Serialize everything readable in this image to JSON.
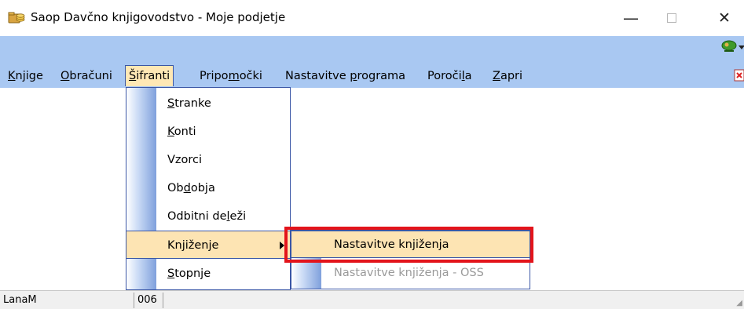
{
  "window": {
    "title": "Saop Davčno knjigovodstvo - Moje podjetje",
    "icon": "coins-folder-icon",
    "minimize_glyph": "—",
    "close_glyph": "✕"
  },
  "toolbar": {
    "icon": "tree-person-icon"
  },
  "menubar": {
    "items": [
      {
        "pre": "",
        "key": "K",
        "post": "njige"
      },
      {
        "pre": "",
        "key": "O",
        "post": "bračuni"
      },
      {
        "pre": "",
        "key": "Š",
        "post": "ifranti"
      },
      {
        "pre": "Pripo",
        "key": "m",
        "post": "očki"
      },
      {
        "pre": "Nastavitve ",
        "key": "p",
        "post": "rograma"
      },
      {
        "pre": "Poroči",
        "key": "l",
        "post": "a"
      },
      {
        "pre": "",
        "key": "Z",
        "post": "apri"
      }
    ],
    "open_item": "Šifranti"
  },
  "sifranti_menu": {
    "items": [
      {
        "pre": "",
        "key": "S",
        "post": "tranke"
      },
      {
        "pre": "",
        "key": "K",
        "post": "onti"
      },
      {
        "pre": "Vzorci",
        "key": "",
        "post": ""
      },
      {
        "pre": "Ob",
        "key": "d",
        "post": "obja"
      },
      {
        "pre": "Odbitni de",
        "key": "l",
        "post": "eži"
      },
      {
        "pre": "Knjiženje",
        "key": "",
        "post": ""
      },
      {
        "pre": "",
        "key": "S",
        "post": "topnje"
      }
    ],
    "highlighted": "Knjiženje"
  },
  "knjizenje_submenu": {
    "items": [
      {
        "label": "Nastavitve knjiženja",
        "enabled": true
      },
      {
        "label": "Nastavitve knjiženja - OSS",
        "enabled": false
      }
    ]
  },
  "statusbar": {
    "user": "LanaM",
    "code": "006"
  },
  "colors": {
    "menubar_bg": "#a9c8f2",
    "highlight_bg": "#fde4b3",
    "menu_border": "#3a56a6",
    "annotation_red": "#e3141b"
  }
}
